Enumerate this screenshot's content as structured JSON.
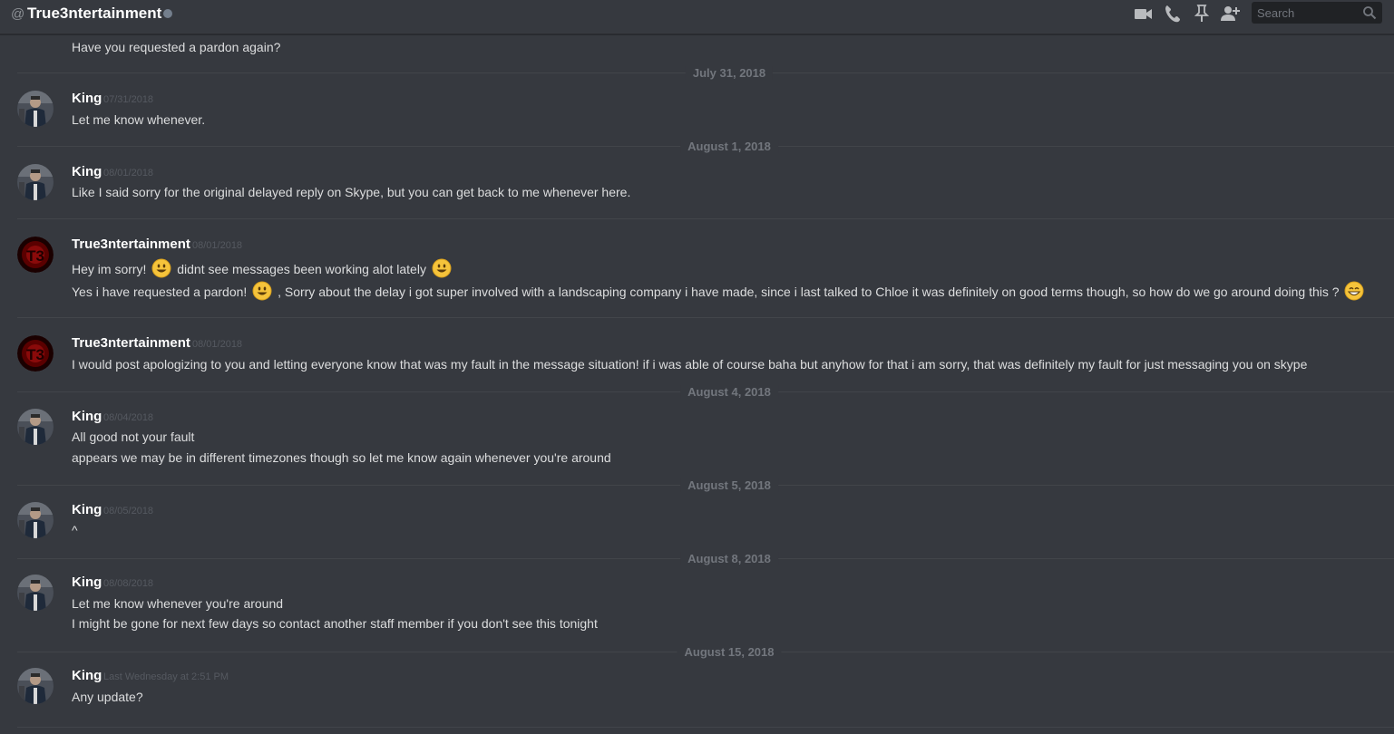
{
  "header": {
    "at_symbol": "@",
    "channel_name": "True3ntertainment",
    "search_placeholder": "Search",
    "icons": [
      "video-call-icon",
      "voice-call-icon",
      "pin-icon",
      "add-friend-icon",
      "search-icon"
    ]
  },
  "colors": {
    "background": "#36393f",
    "text": "#dcddde",
    "username": "#ffffff",
    "timestamp": "#555960",
    "divider": "#42454a",
    "date_label": "#72767d",
    "emoji_yellow": "#f5c33b"
  },
  "messages": {
    "top_line": "Have you requested a pardon again?",
    "dates": [
      "July 31, 2018",
      "August 1, 2018",
      "August 4, 2018",
      "August 5, 2018",
      "August 8, 2018",
      "August 15, 2018"
    ],
    "groups": [
      {
        "author": "King",
        "time": "07/31/2018",
        "lines": [
          "Let me know whenever."
        ]
      },
      {
        "author": "King",
        "time": "08/01/2018",
        "lines": [
          "Like I said sorry for the original delayed reply on Skype, but you can get back to me whenever here."
        ]
      },
      {
        "author": "True3ntertainment",
        "time": "08/01/2018",
        "lines": [
          {
            "part1": "Hey im sorry!",
            "part2": "didnt see messages been working alot lately"
          },
          {
            "part1": "Yes i have requested a pardon!",
            "part2": ", Sorry about the delay i got super involved with a landscaping company i have made, since i last talked to Chloe it was definitely on good terms though, so how do we go around doing this ?"
          }
        ]
      },
      {
        "author": "True3ntertainment",
        "time": "08/01/2018",
        "lines": [
          "I would post apologizing to you and letting everyone know that was my fault in the message situation! if i was able of course baha but anyhow for that i am sorry, that was definitely my fault for just messaging you on skype"
        ]
      },
      {
        "author": "King",
        "time": "08/04/2018",
        "lines": [
          "All good not your fault",
          "appears we may be in different timezones though so let me know again whenever you're around"
        ]
      },
      {
        "author": "King",
        "time": "08/05/2018",
        "lines": [
          "^"
        ]
      },
      {
        "author": "King",
        "time": "08/08/2018",
        "lines": [
          "Let me know whenever you're around",
          "I might be gone for next few days so contact another staff member if you don't see this tonight"
        ]
      },
      {
        "author": "King",
        "time": "Last Wednesday at 2:51 PM",
        "lines": [
          "Any update?"
        ]
      }
    ]
  }
}
